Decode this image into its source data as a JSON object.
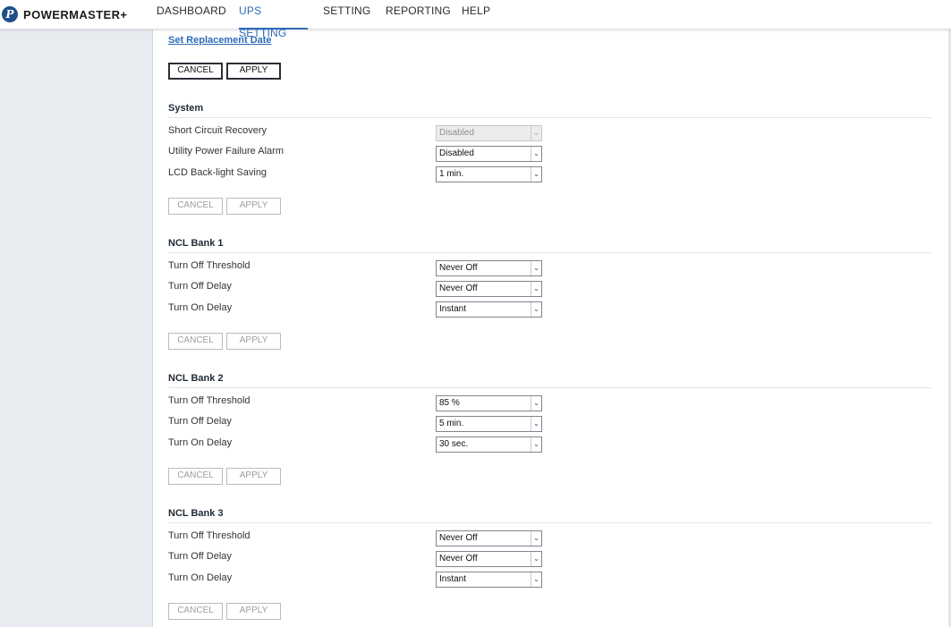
{
  "brand": {
    "name": "POWERMASTER+",
    "logo_letter": "P"
  },
  "nav": [
    {
      "label": "DASHBOARD",
      "active": false
    },
    {
      "label": "UPS SETTING",
      "active": true
    },
    {
      "label": "SETTING",
      "active": false
    },
    {
      "label": "REPORTING",
      "active": false
    },
    {
      "label": "HELP",
      "active": false
    }
  ],
  "replacement": {
    "link_label": "Set Replacement Date",
    "cancel_label": "CANCEL",
    "apply_label": "APPLY"
  },
  "sections": [
    {
      "title": "System",
      "rows": [
        {
          "label": "Short Circuit Recovery",
          "value": "Disabled",
          "disabled": true
        },
        {
          "label": "Utility Power Failure Alarm",
          "value": "Disabled",
          "disabled": false
        },
        {
          "label": "LCD Back-light Saving",
          "value": "1 min.",
          "disabled": false
        }
      ],
      "cancel_label": "CANCEL",
      "apply_label": "APPLY"
    },
    {
      "title": "NCL Bank 1",
      "rows": [
        {
          "label": "Turn Off Threshold",
          "value": "Never Off"
        },
        {
          "label": "Turn Off Delay",
          "value": "Never Off"
        },
        {
          "label": "Turn On Delay",
          "value": "Instant"
        }
      ],
      "cancel_label": "CANCEL",
      "apply_label": "APPLY"
    },
    {
      "title": "NCL Bank 2",
      "rows": [
        {
          "label": "Turn Off Threshold",
          "value": "85 %"
        },
        {
          "label": "Turn Off Delay",
          "value": "5 min."
        },
        {
          "label": "Turn On Delay",
          "value": "30 sec."
        }
      ],
      "cancel_label": "CANCEL",
      "apply_label": "APPLY"
    },
    {
      "title": "NCL Bank 3",
      "rows": [
        {
          "label": "Turn Off Threshold",
          "value": "Never Off"
        },
        {
          "label": "Turn Off Delay",
          "value": "Never Off"
        },
        {
          "label": "Turn On Delay",
          "value": "Instant"
        }
      ],
      "cancel_label": "CANCEL",
      "apply_label": "APPLY"
    }
  ],
  "icons": {
    "dropdown": "chevron-down-icon",
    "logo": "powermaster-logo-icon"
  },
  "colors": {
    "accent": "#2c6bb8",
    "sidebar": "#e8ebef"
  }
}
